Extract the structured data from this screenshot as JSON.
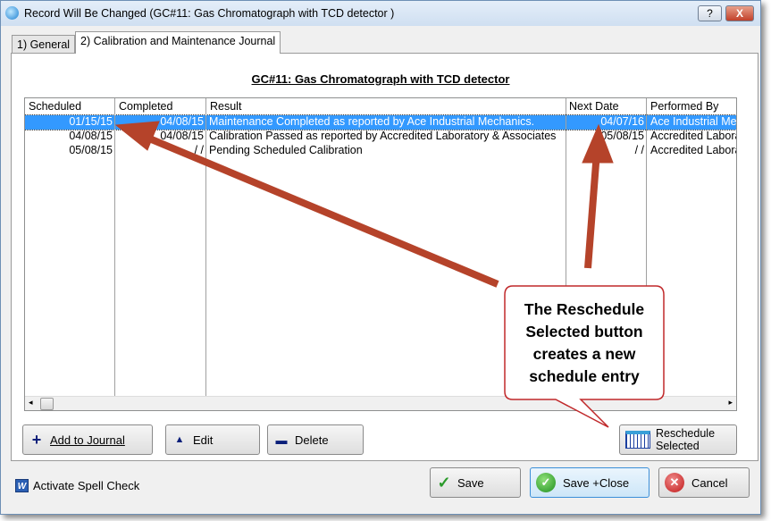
{
  "window": {
    "title": "Record Will Be Changed  (GC#11: Gas Chromatograph with TCD detector                    )",
    "help": "?",
    "close": "X"
  },
  "tabs": [
    {
      "label": "1) General"
    },
    {
      "label": "2) Calibration and Maintenance Journal"
    }
  ],
  "heading": "GC#11: Gas Chromatograph with TCD detector",
  "table": {
    "columns": [
      "Scheduled",
      "Completed",
      "Result",
      "Next Date",
      "Performed By"
    ],
    "rows": [
      [
        "01/15/15",
        "04/08/15",
        "Maintenance Completed as reported by Ace Industrial Mechanics.",
        "04/07/16",
        "Ace Industrial Mechanics"
      ],
      [
        "04/08/15",
        "04/08/15",
        "Calibration Passed as reported by Accredited Laboratory & Associates",
        "05/08/15",
        "Accredited Laboratory"
      ],
      [
        "05/08/15",
        "/ /",
        "Pending Scheduled Calibration",
        "/ /",
        "Accredited Laboratory"
      ]
    ],
    "selected_row": 0
  },
  "buttons": {
    "add": "Add to Journal",
    "edit": "Edit",
    "delete": "Delete",
    "reschedule1": "Reschedule",
    "reschedule2": "Selected",
    "save": "Save",
    "save_close": "Save +Close",
    "cancel": "Cancel"
  },
  "spell_check": "Activate Spell Check",
  "callout": {
    "text": "The Reschedule Selected button creates a new schedule entry"
  },
  "colors": {
    "arrow": "#b5432a",
    "callout_border": "#c0282a",
    "selection": "#3399ff"
  }
}
